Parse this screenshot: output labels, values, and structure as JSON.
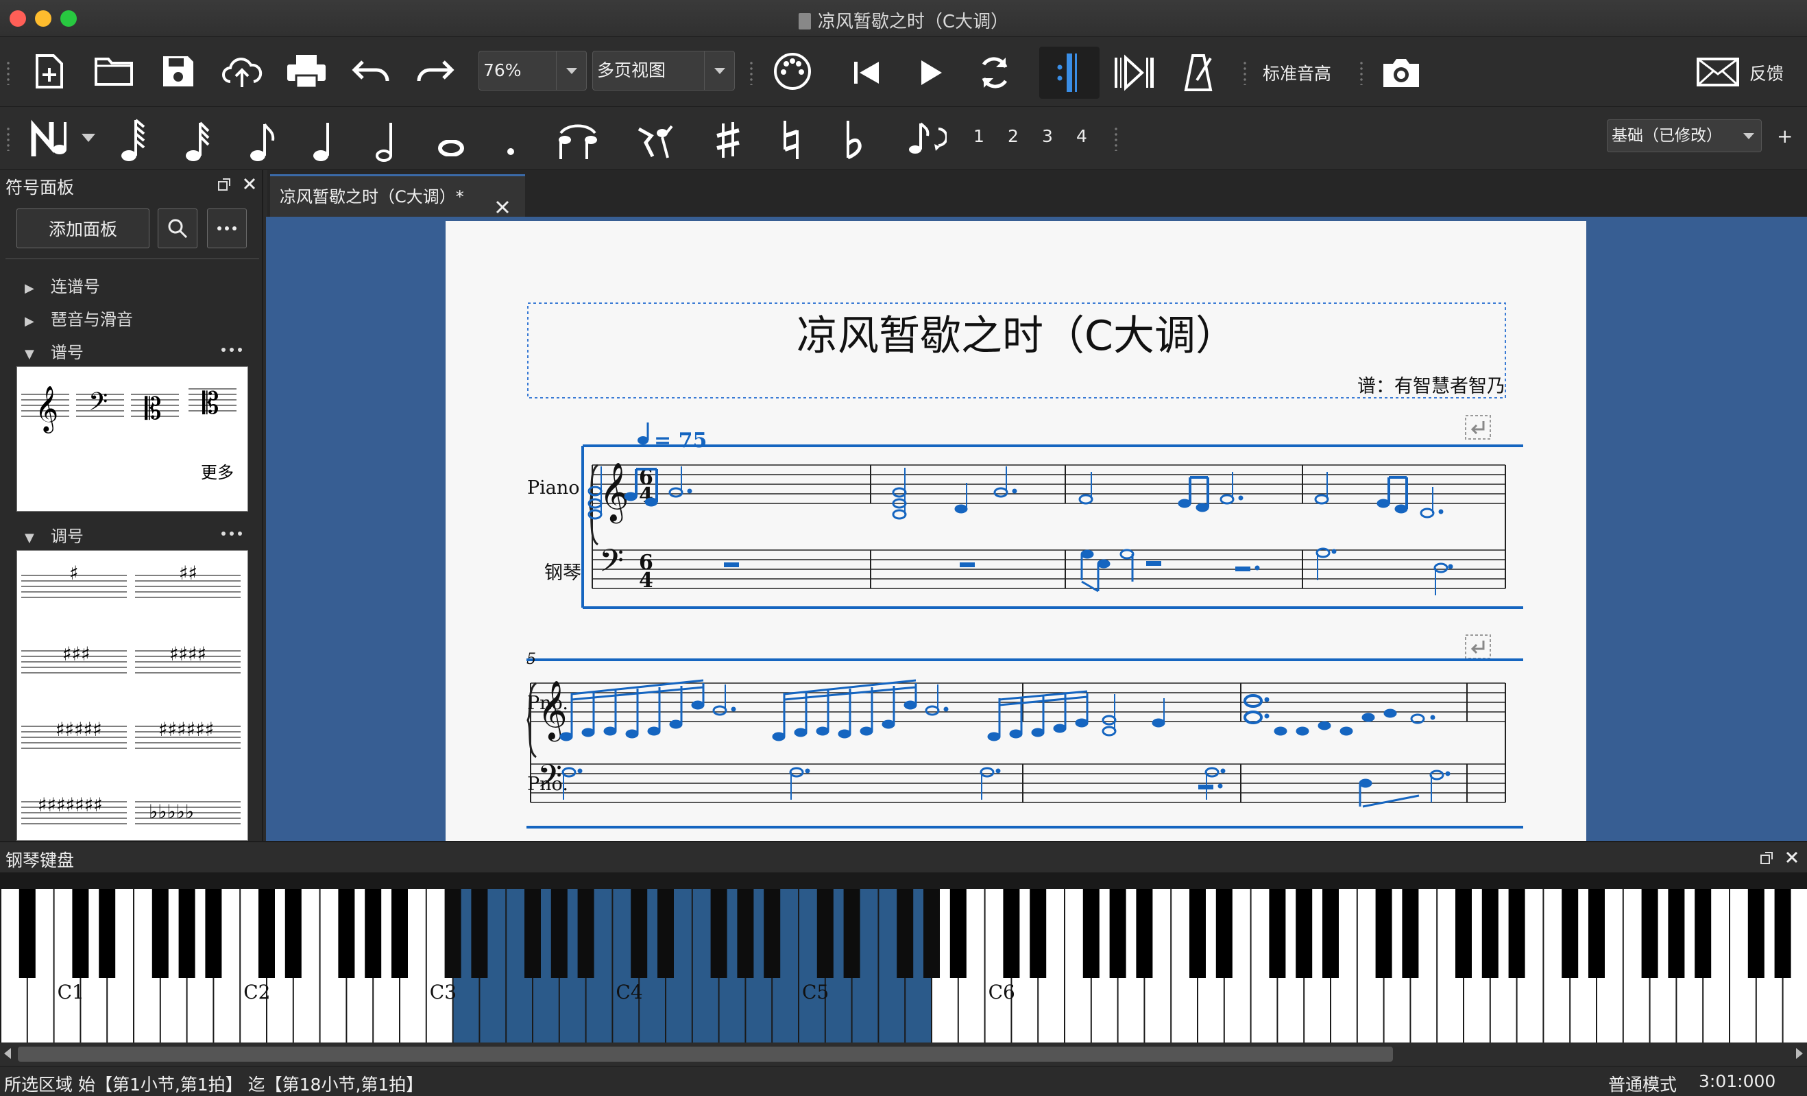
{
  "window": {
    "title": "凉风暂歇之时（C大调）"
  },
  "toolbar": {
    "zoom": "76%",
    "view_mode": "多页视图",
    "concert_pitch": "标准音高",
    "feedback": "反馈"
  },
  "note_toolbar": {
    "voices": [
      "1",
      "2",
      "3",
      "4"
    ],
    "workspace": "基础（已修改）",
    "add": "+"
  },
  "palette": {
    "title": "符号面板",
    "add_button": "添加面板",
    "sections": [
      {
        "label": "连谱号",
        "expanded": false
      },
      {
        "label": "琶音与滑音",
        "expanded": false
      },
      {
        "label": "谱号",
        "expanded": true
      },
      {
        "label": "调号",
        "expanded": true
      }
    ],
    "more_label": "更多"
  },
  "tab": {
    "label": "凉风暂歇之时（C大调）*"
  },
  "score": {
    "title": "凉风暂歇之时（C大调）",
    "composer": "谱：有智慧者智乃",
    "tempo": "= 75",
    "staff1_name": "Piano",
    "staff2_name": "钢琴",
    "staff3_name": "Pno.",
    "staff4_name": "Pno.",
    "time_sig_top": "6",
    "time_sig_bottom": "4",
    "measure_number": "5"
  },
  "keyboard": {
    "title": "钢琴键盘",
    "labels": [
      "C1",
      "C2",
      "C3",
      "C4",
      "C5",
      "C6"
    ],
    "highlight_color": "#2b5a8a"
  },
  "status": {
    "selection": "所选区域 始【第1小节,第1拍】 迄【第18小节,第1拍】",
    "mode": "普通模式",
    "time": "3:01:000"
  },
  "colors": {
    "accent": "#1565c0",
    "canvas_bg": "#375e93"
  }
}
